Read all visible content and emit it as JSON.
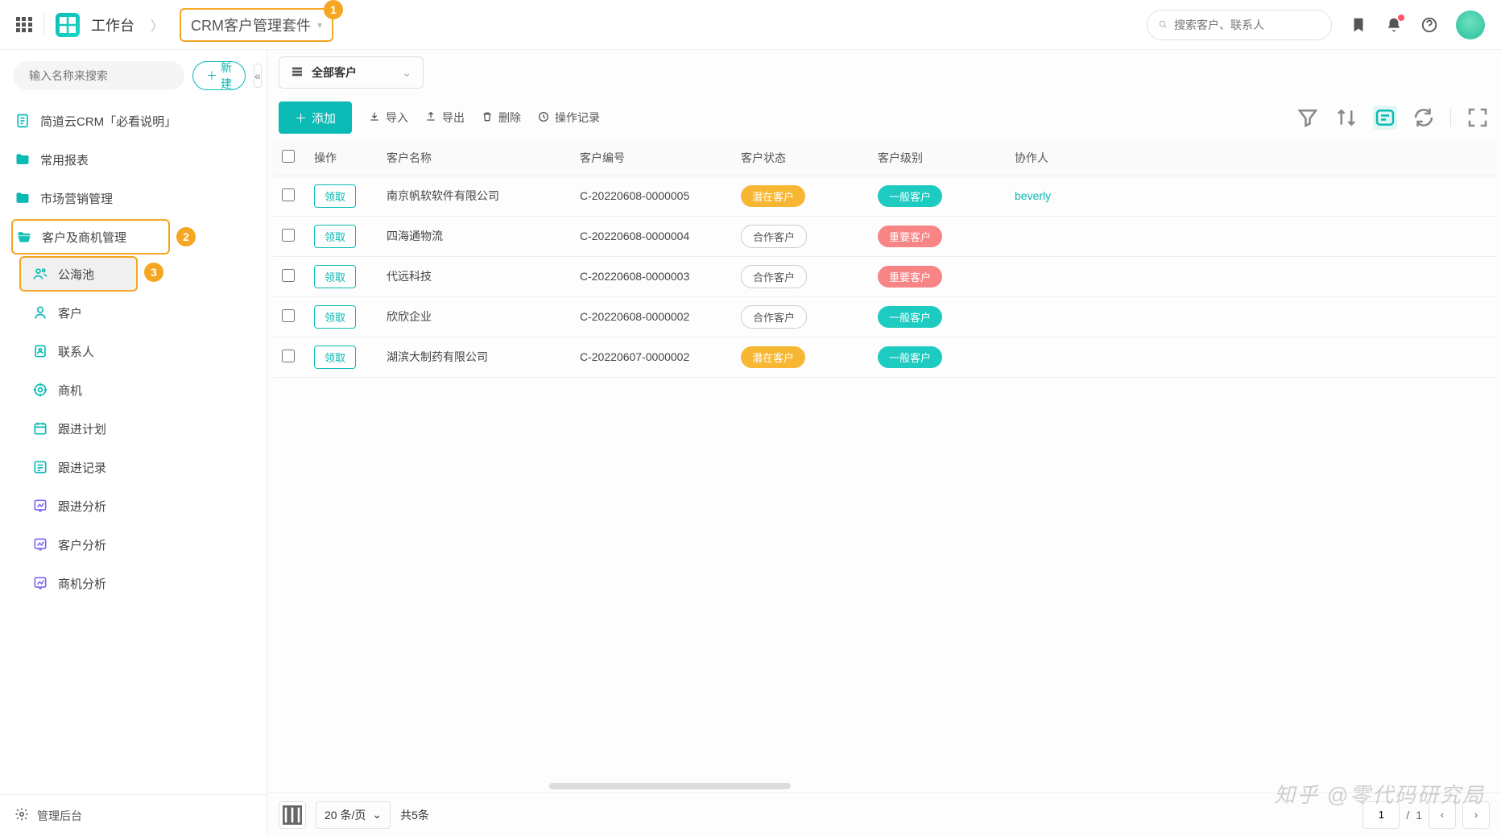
{
  "topnav": {
    "workspace": "工作台",
    "crm_app": "CRM客户管理套件",
    "search_placeholder": "搜索客户、联系人"
  },
  "sidebar": {
    "search_placeholder": "输入名称来搜索",
    "new_btn": "新建",
    "items": {
      "crm_doc": "简道云CRM「必看说明」",
      "reports": "常用报表",
      "marketing": "市场营销管理",
      "customer_mgmt": "客户及商机管理",
      "public_pool": "公海池",
      "customer": "客户",
      "contact": "联系人",
      "opportunity": "商机",
      "followup_plan": "跟进计划",
      "followup_record": "跟进记录",
      "followup_analysis": "跟进分析",
      "customer_analysis": "客户分析",
      "opportunity_analysis": "商机分析"
    },
    "footer": "管理后台"
  },
  "annotations": {
    "a1": "1",
    "a2": "2",
    "a3": "3"
  },
  "content": {
    "view_name": "全部客户",
    "add_btn": "添加",
    "import_btn": "导入",
    "export_btn": "导出",
    "delete_btn": "删除",
    "history_btn": "操作记录"
  },
  "table": {
    "headers": {
      "action": "操作",
      "name": "客户名称",
      "code": "客户编号",
      "status": "客户状态",
      "level": "客户级别",
      "collaborator": "协作人"
    },
    "claim_label": "领取",
    "rows": [
      {
        "name": "南京帆软软件有限公司",
        "code": "C-20220608-0000005",
        "status": "潜在客户",
        "status_style": "yellow",
        "level": "一般客户",
        "level_style": "teal",
        "collaborator": "beverly"
      },
      {
        "name": "四海通物流",
        "code": "C-20220608-0000004",
        "status": "合作客户",
        "status_style": "outline",
        "level": "重要客户",
        "level_style": "pink",
        "collaborator": ""
      },
      {
        "name": "代远科技",
        "code": "C-20220608-0000003",
        "status": "合作客户",
        "status_style": "outline",
        "level": "重要客户",
        "level_style": "pink",
        "collaborator": ""
      },
      {
        "name": "欣欣企业",
        "code": "C-20220608-0000002",
        "status": "合作客户",
        "status_style": "outline",
        "level": "一般客户",
        "level_style": "teal",
        "collaborator": ""
      },
      {
        "name": "湖滨大制药有限公司",
        "code": "C-20220607-0000002",
        "status": "潜在客户",
        "status_style": "yellow",
        "level": "一般客户",
        "level_style": "teal",
        "collaborator": ""
      }
    ]
  },
  "pagination": {
    "page_size_label": "20 条/页",
    "total_label": "共5条",
    "current": "1",
    "sep": "/",
    "total_pages": "1"
  },
  "watermark": "知乎 @零代码研究局"
}
